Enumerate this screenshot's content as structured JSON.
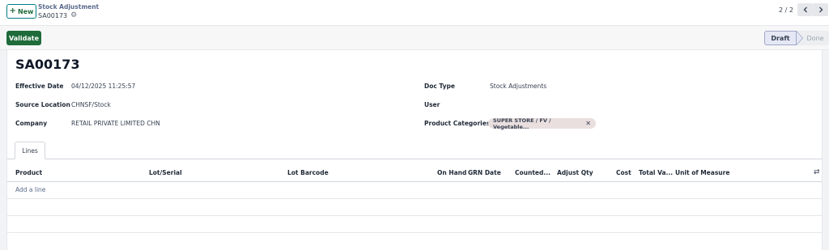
{
  "header": {
    "new_label": "New",
    "breadcrumb_parent": "Stock Adjustment",
    "breadcrumb_current": "SA00173",
    "pager_text": "2 / 2"
  },
  "actions": {
    "validate_label": "Validate",
    "status_steps": [
      "Draft",
      "Done"
    ],
    "status_current": "Draft"
  },
  "form": {
    "reference": "SA00173",
    "effective_date_label": "Effective Date",
    "effective_date_value": "04/12/2025 11:25:57",
    "source_location_label": "Source Location",
    "source_location_value": "CHNSF/Stock",
    "company_label": "Company",
    "company_value": "RETAIL PRIVATE LIMITED CHN",
    "doc_type_label": "Doc Type",
    "doc_type_value": "Stock Adjustments",
    "user_label": "User",
    "user_value": "",
    "product_categories_label": "Product Categories",
    "product_categories_tag": "SUPER STORE / FV / Vegetable..."
  },
  "tabs": [
    {
      "label": "Lines"
    }
  ],
  "table": {
    "columns": [
      "Product",
      "Lot/Serial",
      "Lot Barcode",
      "On Hand",
      "GRN Date",
      "Counted...",
      "Adjust Qty",
      "Cost",
      "Total Va...",
      "Unit of Measure"
    ],
    "add_line_label": "Add a line"
  },
  "colors": {
    "primary_green": "#1f6b3a",
    "link_blue": "#5b6b8c",
    "tag_bg": "#eadfdf"
  }
}
